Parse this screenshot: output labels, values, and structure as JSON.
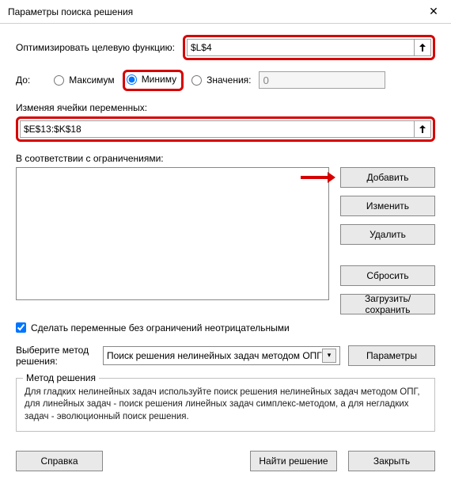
{
  "window": {
    "title": "Параметры поиска решения"
  },
  "objective": {
    "label": "Оптимизировать целевую функцию:",
    "value": "$L$4"
  },
  "to": {
    "label": "До:",
    "max": "Максимум",
    "min": "Миниму",
    "value_label": "Значения:",
    "value": "0",
    "selected": "min"
  },
  "varcells": {
    "label": "Изменяя ячейки переменных:",
    "value": "$E$13:$K$18"
  },
  "constraints": {
    "label": "В соответствии с ограничениями:",
    "items": []
  },
  "side_buttons": {
    "add": "Добавить",
    "change": "Изменить",
    "delete": "Удалить",
    "reset": "Сбросить",
    "loadsave": "Загрузить/сохранить"
  },
  "nonnegative": {
    "label": "Сделать переменные без ограничений неотрицательными",
    "checked": true
  },
  "method": {
    "label": "Выберите метод решения:",
    "selected": "Поиск решения нелинейных задач методом ОПГ",
    "params_btn": "Параметры"
  },
  "groupbox": {
    "title": "Метод решения",
    "text": "Для гладких нелинейных задач используйте поиск решения нелинейных задач методом ОПГ, для линейных задач - поиск решения линейных задач симплекс-методом, а для негладких задач - эволюционный поиск решения."
  },
  "footer": {
    "help": "Справка",
    "solve": "Найти решение",
    "close": "Закрыть"
  }
}
